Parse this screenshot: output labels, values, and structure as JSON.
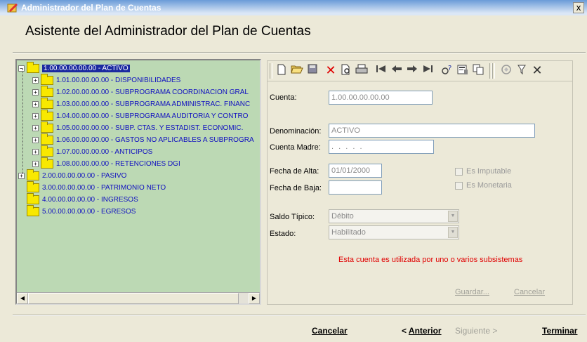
{
  "window": {
    "title": "Administrador del Plan de Cuentas",
    "close_label": "x"
  },
  "wizard": {
    "heading": "Asistente del Administrador del Plan de Cuentas"
  },
  "tree": {
    "items": [
      {
        "label": "1.00.00.00.00.00  -  ACTIVO",
        "expander": "−",
        "selected": true
      },
      {
        "label": "1.01.00.00.00.00  -  DISPONIBILIDADES",
        "expander": "+"
      },
      {
        "label": "1.02.00.00.00.00  -  SUBPROGRAMA COORDINACION GRAL",
        "expander": "+"
      },
      {
        "label": "1.03.00.00.00.00  -  SUBPROGRAMA ADMINISTRAC. FINANC",
        "expander": "+"
      },
      {
        "label": "1.04.00.00.00.00  -  SUBPROGRAMA AUDITORIA Y CONTRO",
        "expander": "+"
      },
      {
        "label": "1.05.00.00.00.00  -  SUBP. CTAS. Y ESTADIST. ECONOMIC.",
        "expander": "+"
      },
      {
        "label": "1.06.00.00.00.00  -  GASTOS NO APLICABLES A SUBPROGRA",
        "expander": "+"
      },
      {
        "label": "1.07.00.00.00.00  -  ANTICIPOS",
        "expander": "+"
      },
      {
        "label": "1.08.00.00.00.00  -  RETENCIONES DGI",
        "expander": "+"
      },
      {
        "label": "2.00.00.00.00.00  -  PASIVO",
        "expander": "+"
      },
      {
        "label": "3.00.00.00.00.00  -  PATRIMONIO NETO",
        "expander": ""
      },
      {
        "label": "4.00.00.00.00.00  -  INGRESOS",
        "expander": ""
      },
      {
        "label": "5.00.00.00.00.00  -  EGRESOS",
        "expander": ""
      }
    ]
  },
  "form": {
    "cuenta_label": "Cuenta:",
    "cuenta_value": "1.00.00.00.00.00",
    "denominacion_label": "Denominación:",
    "denominacion_value": "ACTIVO",
    "cuenta_madre_label": "Cuenta Madre:",
    "cuenta_madre_value": ". . . . .",
    "fecha_alta_label": "Fecha de Alta:",
    "fecha_alta_value": "01/01/2000",
    "fecha_baja_label": "Fecha de Baja:",
    "fecha_baja_value": "",
    "es_imputable_label": "Es Imputable",
    "es_monetaria_label": "Es Monetaria",
    "saldo_tipico_label": "Saldo Típico:",
    "saldo_tipico_value": "Débito",
    "estado_label": "Estado:",
    "estado_value": "Habilitado",
    "warning": "Esta cuenta es utilizada por uno o varios subsistemas",
    "guardar_label": "Guardar...",
    "cancelar_label": "Cancelar"
  },
  "footer": {
    "cancelar": "Cancelar",
    "anterior_prefix": "< ",
    "anterior": "Anterior",
    "siguiente": "Siguiente >",
    "terminar": "Terminar"
  }
}
